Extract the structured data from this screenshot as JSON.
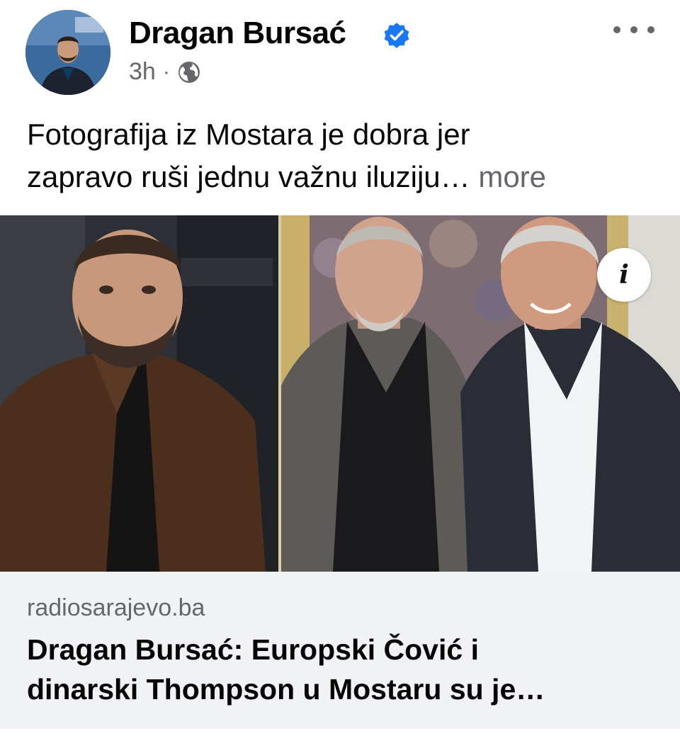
{
  "post": {
    "author": {
      "name": "Dragan Bursać",
      "verified": true,
      "avatar_icon": "profile-photo"
    },
    "timestamp": "3h",
    "separator": "·",
    "audience_icon": "globe-icon",
    "caption": {
      "text_line1": "Fotografija iz Mostara je dobra jer",
      "text_line2": "zapravo ruši jednu važnu iluziju…",
      "see_more": "more"
    },
    "link": {
      "info_glyph": "i",
      "domain": "radiosarajevo.ba",
      "title_line1": "Dragan Bursać: Europski Čović i",
      "title_line2": "dinarski Thompson u Mostaru su je…"
    }
  },
  "colors": {
    "text_primary": "#050505",
    "text_secondary": "#65676b",
    "verified_blue": "#1877f2",
    "footer_bg": "#f0f2f5"
  }
}
